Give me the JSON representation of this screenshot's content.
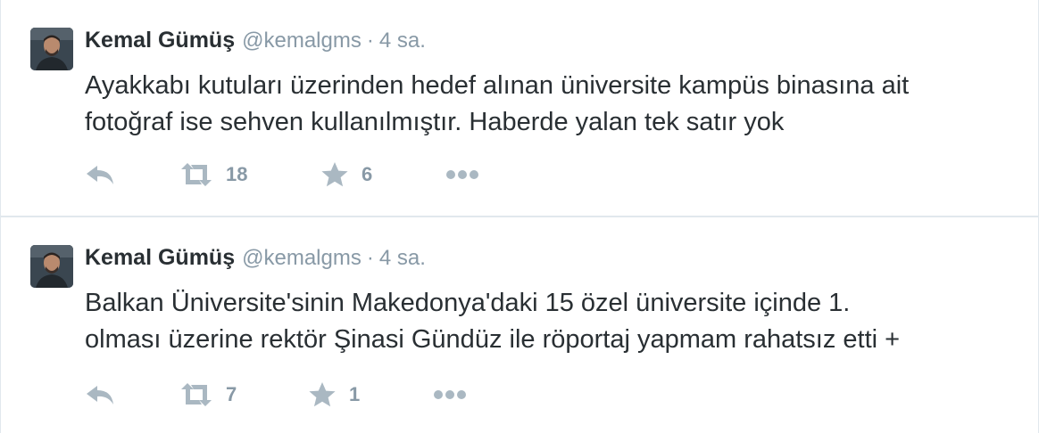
{
  "tweets": [
    {
      "author": {
        "name": "Kemal Gümüş",
        "handle": "@kemalgms"
      },
      "separator": "·",
      "time": "4 sa.",
      "text_lines": [
        "Ayakkabı kutuları üzerinden hedef alınan üniversite kampüs binasına ait",
        "fotoğraf ise sehven kullanılmıştır. Haberde yalan tek satır yok"
      ],
      "retweet_count": "18",
      "favorite_count": "6"
    },
    {
      "author": {
        "name": "Kemal Gümüş",
        "handle": "@kemalgms"
      },
      "separator": "·",
      "time": "4 sa.",
      "text_lines": [
        "Balkan Üniversite'sinin Makedonya'daki 15 özel üniversite içinde 1.",
        "olması üzerine rektör Şinasi Gündüz ile röportaj yapmam rahatsız etti +"
      ],
      "retweet_count": "7",
      "favorite_count": "1"
    }
  ],
  "icons": {
    "reply": "reply-icon",
    "retweet": "retweet-icon",
    "favorite": "star-icon",
    "more": "more-icon"
  },
  "colors": {
    "action_icon": "#aab8c2",
    "secondary_text": "#8899a6",
    "primary_text": "#292f33",
    "divider": "#e1e8ed"
  }
}
